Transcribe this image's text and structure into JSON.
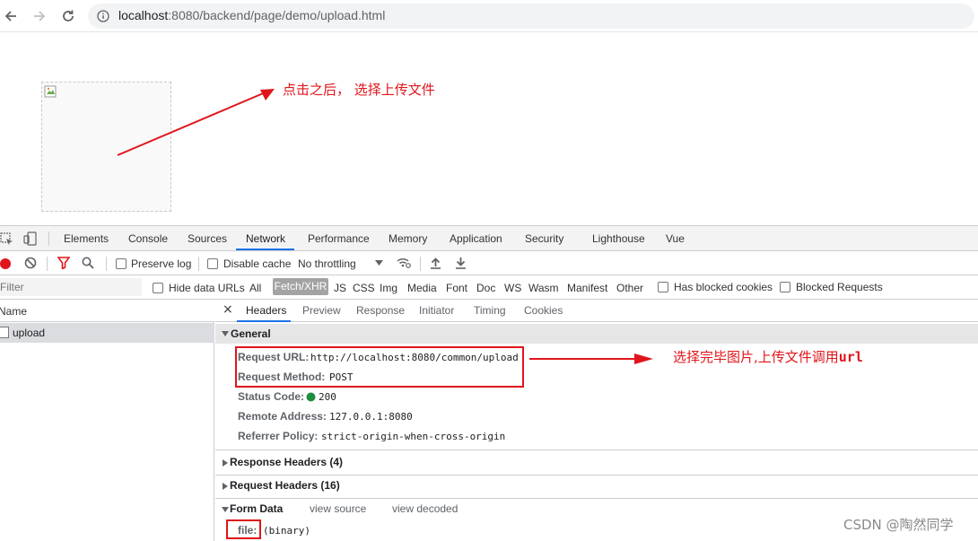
{
  "browser": {
    "url_host": "localhost",
    "url_rest": ":8080/backend/page/demo/upload.html"
  },
  "annotations": {
    "top": "点击之后，  选择上传文件",
    "right_prefix": "选择完毕图片,上传文件调用",
    "right_code": "url"
  },
  "devtools": {
    "tabs": [
      "Elements",
      "Console",
      "Sources",
      "Network",
      "Performance",
      "Memory",
      "Application",
      "Security",
      "Lighthouse",
      "Vue"
    ],
    "toolbar": {
      "preserve_log": "Preserve log",
      "disable_cache": "Disable cache",
      "throttling": "No throttling"
    },
    "filter": {
      "placeholder": "Filter",
      "hide_data_urls": "Hide data URLs",
      "types": [
        "All",
        "Fetch/XHR",
        "JS",
        "CSS",
        "Img",
        "Media",
        "Font",
        "Doc",
        "WS",
        "Wasm",
        "Manifest",
        "Other"
      ],
      "has_blocked_cookies": "Has blocked cookies",
      "blocked_requests": "Blocked Requests"
    },
    "list": {
      "name_header": "Name",
      "rows": [
        "upload"
      ]
    },
    "details": {
      "close": "×",
      "tabs": [
        "Headers",
        "Preview",
        "Response",
        "Initiator",
        "Timing",
        "Cookies"
      ],
      "general_title": "General",
      "request_url_key": "Request URL:",
      "request_url_val": "http://localhost:8080/common/upload",
      "request_method_key": "Request Method:",
      "request_method_val": "POST",
      "status_code_key": "Status Code:",
      "status_code_val": "200",
      "remote_address_key": "Remote Address:",
      "remote_address_val": "127.0.0.1:8080",
      "referrer_policy_key": "Referrer Policy:",
      "referrer_policy_val": "strict-origin-when-cross-origin",
      "response_headers": "Response Headers (4)",
      "request_headers": "Request Headers (16)",
      "form_data": "Form Data",
      "view_source": "view source",
      "view_decoded": "view decoded",
      "file_key": "file:",
      "file_val": "(binary)"
    }
  },
  "watermark": "CSDN @陶然同学",
  "colors": {
    "annotation_red": "#e0151b",
    "accent_blue": "#1a73e8",
    "status_green": "#1e8e3e",
    "record_red": "#e0151b"
  }
}
